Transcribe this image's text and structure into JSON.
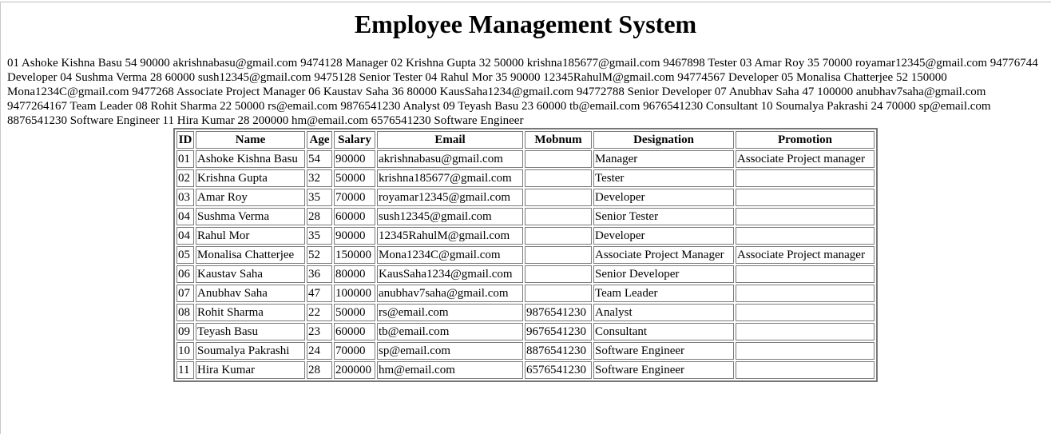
{
  "page": {
    "title": "Employee Management System",
    "raw_text": "01 Ashoke Kishna Basu 54 90000 akrishnabasu@gmail.com 9474128 Manager 02 Krishna Gupta 32 50000 krishna185677@gmail.com 9467898 Tester 03 Amar Roy 35 70000 royamar12345@gmail.com 94776744 Developer 04 Sushma Verma 28 60000 sush12345@gmail.com 9475128 Senior Tester 04 Rahul Mor 35 90000 12345RahulM@gmail.com 94774567 Developer 05 Monalisa Chatterjee 52 150000 Mona1234C@gmail.com 9477268 Associate Project Manager 06 Kaustav Saha 36 80000 KausSaha1234@gmail.com 94772788 Senior Developer 07 Anubhav Saha 47 100000 anubhav7saha@gmail.com 9477264167 Team Leader 08 Rohit Sharma 22 50000 rs@email.com 9876541230 Analyst 09 Teyash Basu 23 60000 tb@email.com 9676541230 Consultant 10 Soumalya Pakrashi 24 70000 sp@email.com 8876541230 Software Engineer 11 Hira Kumar 28 200000 hm@email.com 6576541230 Software Engineer"
  },
  "table": {
    "headers": [
      "ID",
      "Name",
      "Age",
      "Salary",
      "Email",
      "Mobnum",
      "Designation",
      "Promotion"
    ],
    "rows": [
      [
        "01",
        "Ashoke Kishna Basu",
        "54",
        "90000",
        "akrishnabasu@gmail.com",
        "",
        "Manager",
        "Associate Project manager"
      ],
      [
        "02",
        "Krishna Gupta",
        "32",
        "50000",
        "krishna185677@gmail.com",
        "",
        "Tester",
        ""
      ],
      [
        "03",
        "Amar Roy",
        "35",
        "70000",
        "royamar12345@gmail.com",
        "",
        "Developer",
        ""
      ],
      [
        "04",
        "Sushma Verma",
        "28",
        "60000",
        "sush12345@gmail.com",
        "",
        "Senior Tester",
        ""
      ],
      [
        "04",
        "Rahul Mor",
        "35",
        "90000",
        "12345RahulM@gmail.com",
        "",
        "Developer",
        ""
      ],
      [
        "05",
        "Monalisa Chatterjee",
        "52",
        "150000",
        "Mona1234C@gmail.com",
        "",
        "Associate Project Manager",
        "Associate Project manager"
      ],
      [
        "06",
        "Kaustav Saha",
        "36",
        "80000",
        "KausSaha1234@gmail.com",
        "",
        "Senior Developer",
        ""
      ],
      [
        "07",
        "Anubhav Saha",
        "47",
        "100000",
        "anubhav7saha@gmail.com",
        "",
        "Team Leader",
        ""
      ],
      [
        "08",
        "Rohit Sharma",
        "22",
        "50000",
        "rs@email.com",
        "9876541230",
        "Analyst",
        ""
      ],
      [
        "09",
        "Teyash Basu",
        "23",
        "60000",
        "tb@email.com",
        "9676541230",
        "Consultant",
        ""
      ],
      [
        "10",
        "Soumalya Pakrashi",
        "24",
        "70000",
        "sp@email.com",
        "8876541230",
        "Software Engineer",
        ""
      ],
      [
        "11",
        "Hira Kumar",
        "28",
        "200000",
        "hm@email.com",
        "6576541230",
        "Software Engineer",
        ""
      ]
    ]
  }
}
